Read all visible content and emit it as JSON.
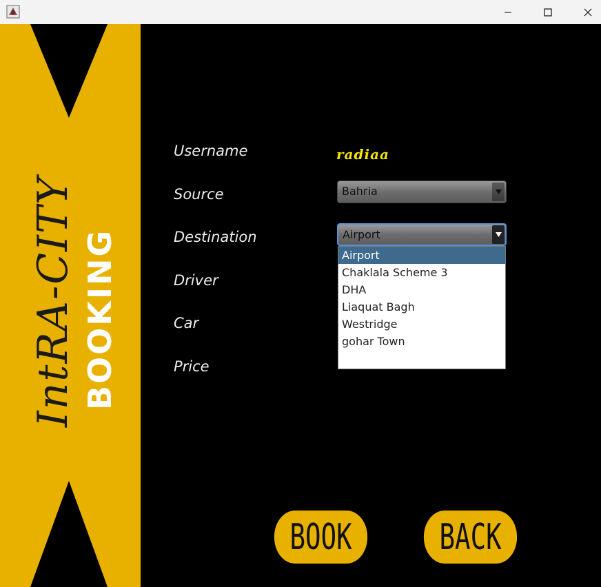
{
  "window": {
    "icon": "java-app-icon",
    "controls": [
      "minimize-icon",
      "maximize-icon",
      "close-icon"
    ]
  },
  "banner": {
    "title_script": "IntRA-CITY",
    "title_bold": "BOOKING",
    "color": "#e8b100"
  },
  "form": {
    "labels": {
      "username": "Username",
      "source": "Source",
      "destination": "Destination",
      "driver": "Driver",
      "car": "Car",
      "price": "Price"
    },
    "username_value": "radiaa",
    "source_selected": "Bahria",
    "destination_selected": "Airport",
    "destination_options": [
      "Airport",
      "Chaklala Scheme 3",
      "DHA",
      "Liaquat Bagh",
      "Westridge",
      "gohar Town"
    ]
  },
  "buttons": {
    "book": "BOOK",
    "back": "BACK"
  },
  "colors": {
    "accent": "#e8b100",
    "username_text": "#f6e600",
    "selection": "#3e6a8e"
  }
}
